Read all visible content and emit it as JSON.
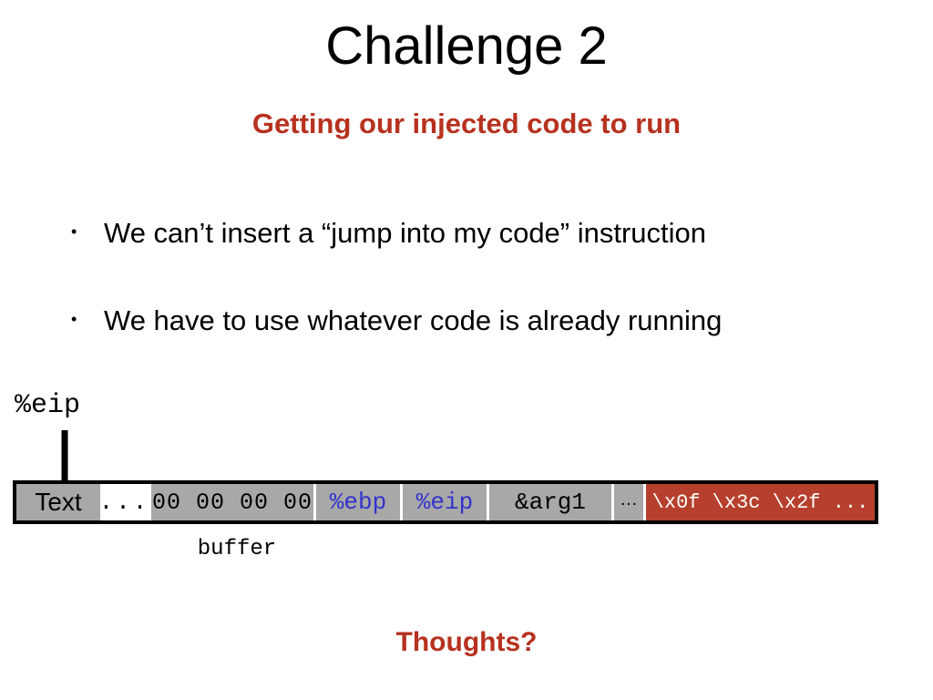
{
  "slide": {
    "title": "Challenge 2",
    "subtitle": "Getting our injected code to run",
    "closing_question": "Thoughts?",
    "accent_color": "#b6321f",
    "bullet_marker": "•",
    "bullets": [
      {
        "text": "We can’t insert a “jump into my code” instruction"
      },
      {
        "text": "We have to use whatever code is already running"
      }
    ]
  },
  "diagram": {
    "pointer_label": "%eip",
    "pointer_icon": "down-arrow-icon",
    "buffer_caption": "buffer",
    "cells": [
      {
        "id": "text",
        "label": "Text",
        "bg": "#a8a8a8",
        "fg": "#000000"
      },
      {
        "id": "gap",
        "label": "...",
        "bg": "#ffffff",
        "fg": "#000000"
      },
      {
        "id": "zeros",
        "label": "00 00 00 00",
        "bg": "#a8a8a8",
        "fg": "#000000"
      },
      {
        "id": "ebp",
        "label": "%ebp",
        "bg": "#a8a8a8",
        "fg": "#3232cd"
      },
      {
        "id": "eip",
        "label": "%eip",
        "bg": "#a8a8a8",
        "fg": "#3232cd"
      },
      {
        "id": "arg1",
        "label": "&arg1",
        "bg": "#a8a8a8",
        "fg": "#000000"
      },
      {
        "id": "ellipsis",
        "label": "…",
        "bg": "#a8a8a8",
        "fg": "#000000"
      },
      {
        "id": "shellcode",
        "label": "\\x0f \\x3c \\x2f ...",
        "bg": "#b6402d",
        "fg": "#ffffff"
      }
    ]
  }
}
